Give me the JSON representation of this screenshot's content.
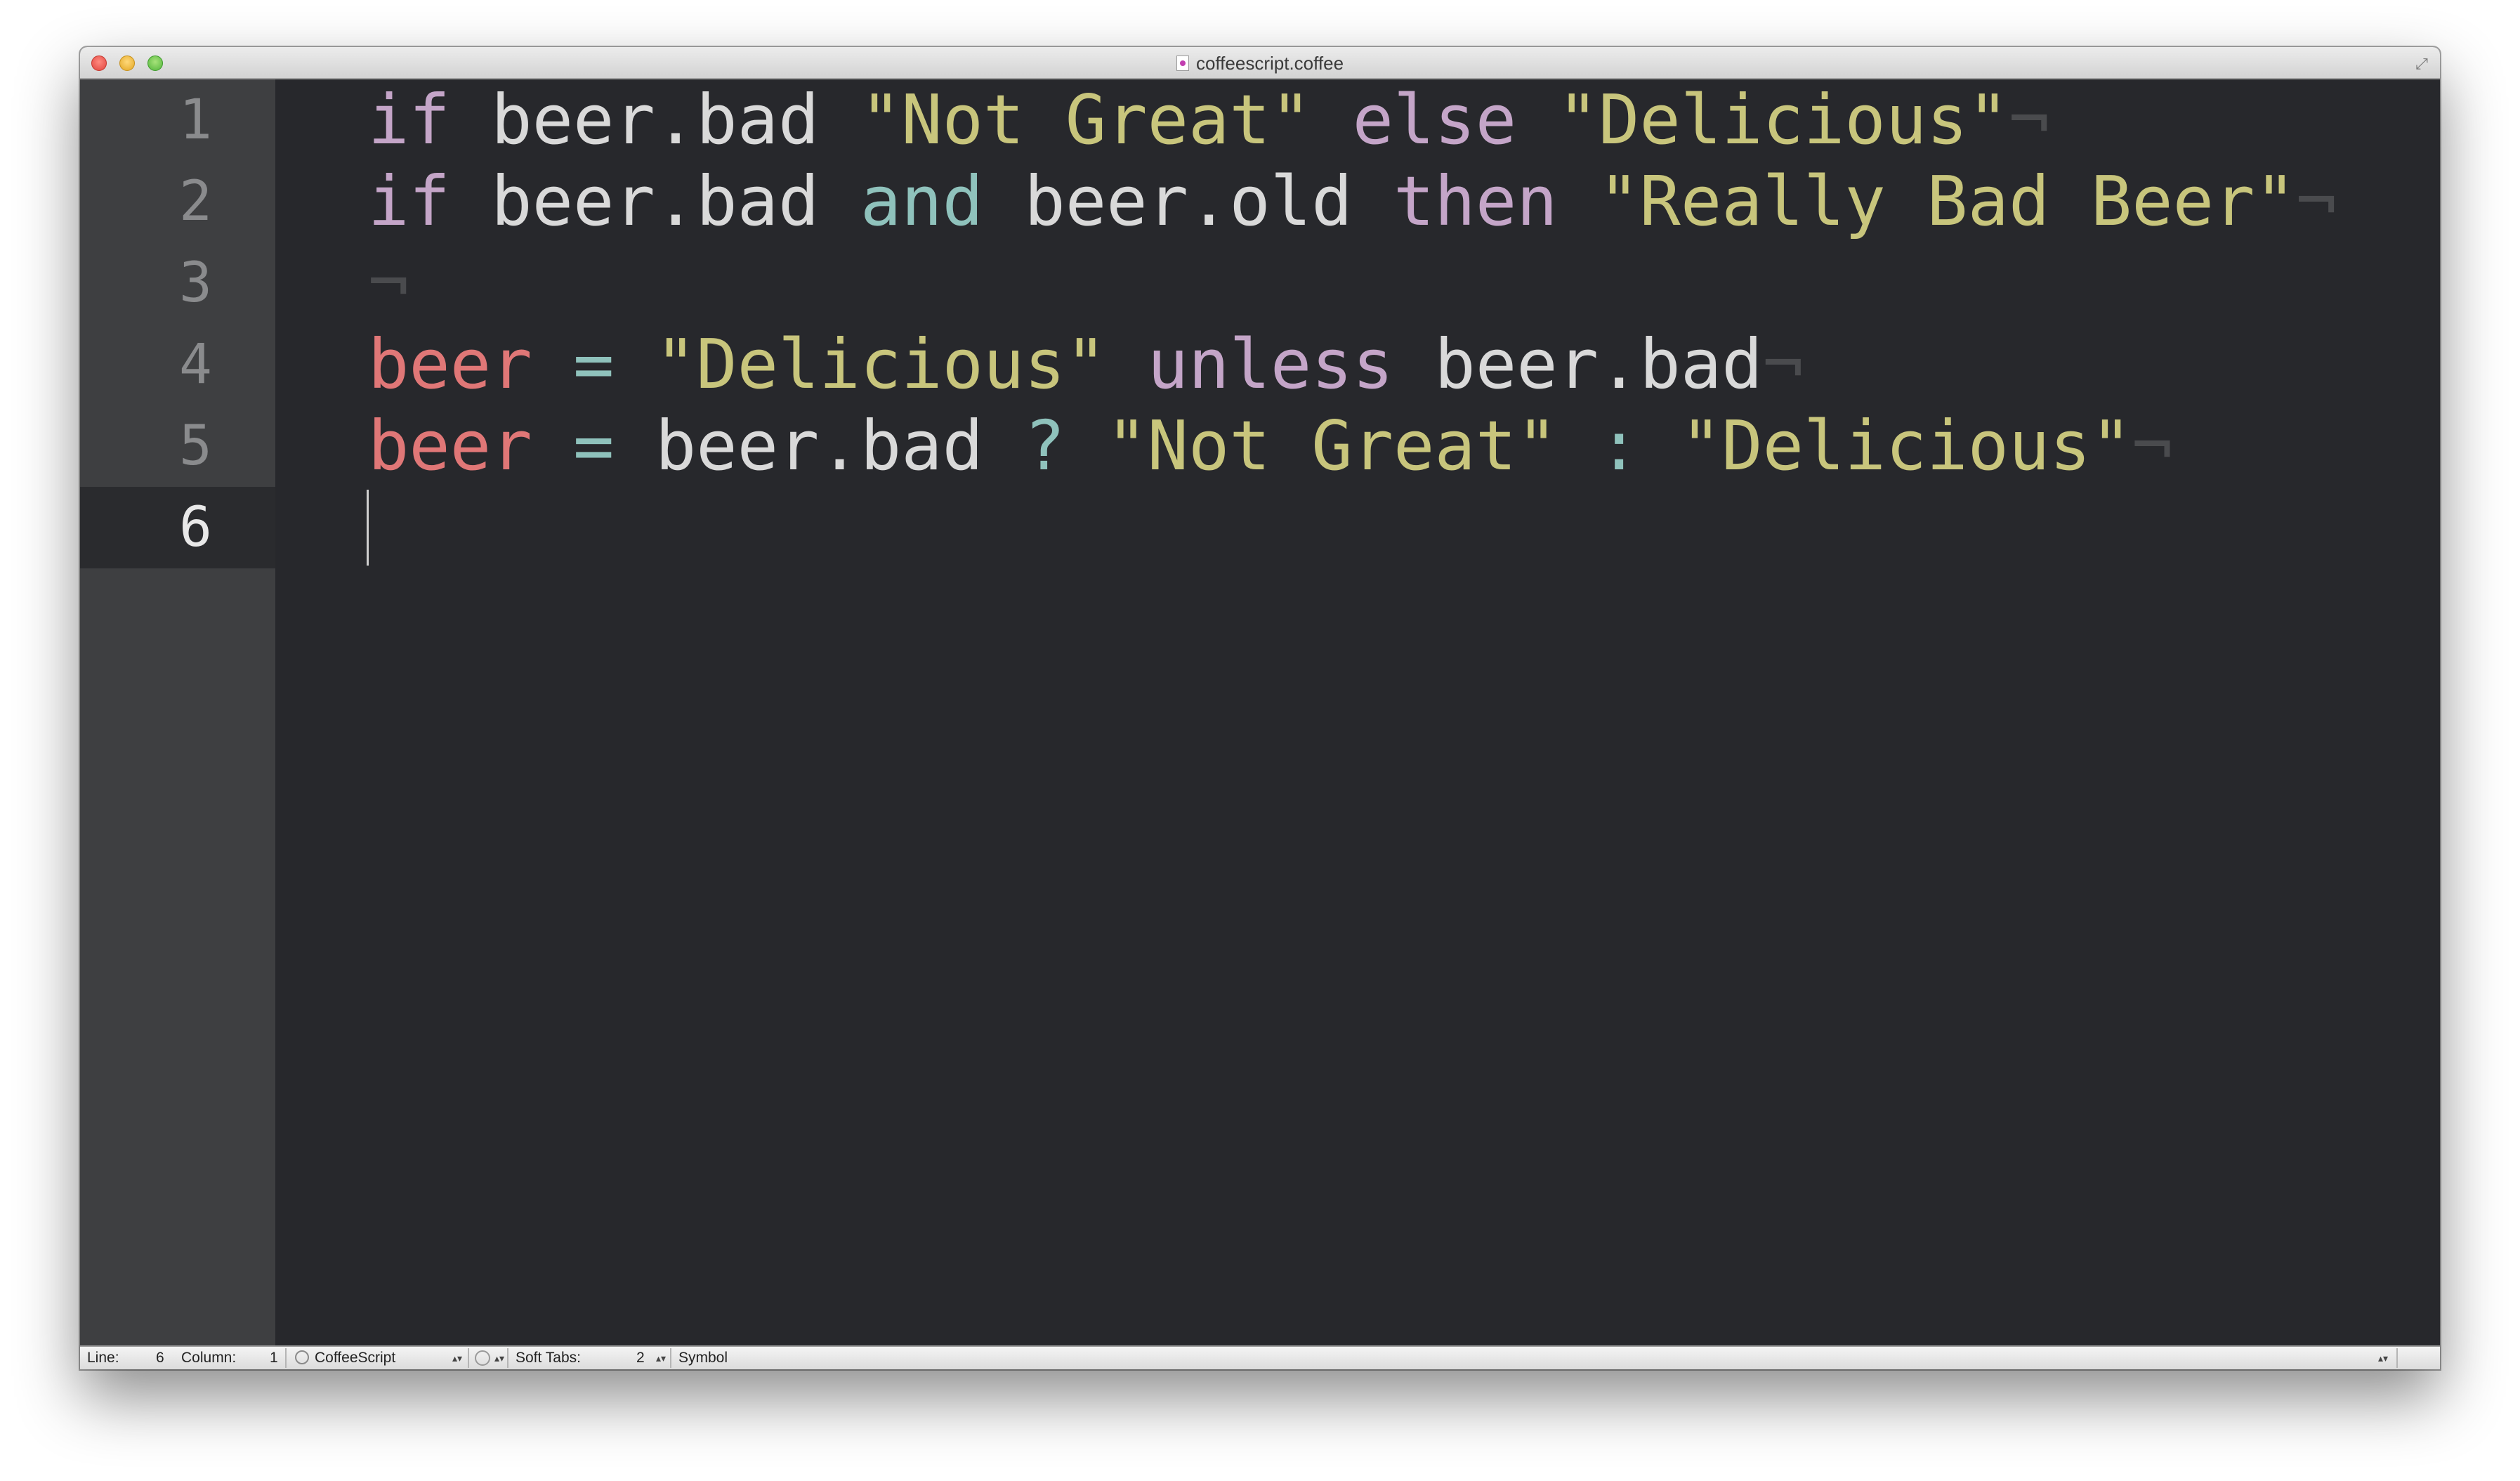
{
  "window": {
    "title": "coffeescript.coffee"
  },
  "gutter": {
    "line_numbers": [
      "1",
      "2",
      "3",
      "4",
      "5",
      "6"
    ],
    "current_line": "6"
  },
  "code": {
    "lines": [
      {
        "tokens": [
          {
            "text": "if",
            "kind": "kw"
          },
          {
            "text": " beer.bad ",
            "kind": "plain"
          },
          {
            "text": "\"Not Great\"",
            "kind": "str"
          },
          {
            "text": " ",
            "kind": "plain"
          },
          {
            "text": "else",
            "kind": "kw"
          },
          {
            "text": " ",
            "kind": "plain"
          },
          {
            "text": "\"Delicious\"",
            "kind": "str"
          },
          {
            "text": "¬",
            "kind": "eol"
          }
        ]
      },
      {
        "tokens": [
          {
            "text": "if",
            "kind": "kw"
          },
          {
            "text": " beer.bad ",
            "kind": "plain"
          },
          {
            "text": "and",
            "kind": "kw2"
          },
          {
            "text": " beer.old ",
            "kind": "plain"
          },
          {
            "text": "then",
            "kind": "kw"
          },
          {
            "text": " ",
            "kind": "plain"
          },
          {
            "text": "\"Really Bad Beer\"",
            "kind": "str"
          },
          {
            "text": "¬",
            "kind": "eol"
          }
        ]
      },
      {
        "tokens": [
          {
            "text": "¬",
            "kind": "eol"
          }
        ]
      },
      {
        "tokens": [
          {
            "text": "beer",
            "kind": "var"
          },
          {
            "text": " ",
            "kind": "plain"
          },
          {
            "text": "=",
            "kind": "op"
          },
          {
            "text": " ",
            "kind": "plain"
          },
          {
            "text": "\"Delicious\"",
            "kind": "str"
          },
          {
            "text": " ",
            "kind": "plain"
          },
          {
            "text": "unless",
            "kind": "kw"
          },
          {
            "text": " beer.bad",
            "kind": "plain"
          },
          {
            "text": "¬",
            "kind": "eol"
          }
        ]
      },
      {
        "tokens": [
          {
            "text": "beer",
            "kind": "var"
          },
          {
            "text": " ",
            "kind": "plain"
          },
          {
            "text": "=",
            "kind": "op"
          },
          {
            "text": " beer.bad ",
            "kind": "plain"
          },
          {
            "text": "?",
            "kind": "op"
          },
          {
            "text": " ",
            "kind": "plain"
          },
          {
            "text": "\"Not Great\"",
            "kind": "str"
          },
          {
            "text": " ",
            "kind": "plain"
          },
          {
            "text": ":",
            "kind": "op"
          },
          {
            "text": " ",
            "kind": "plain"
          },
          {
            "text": "\"Delicious\"",
            "kind": "str"
          },
          {
            "text": "¬",
            "kind": "eol"
          }
        ]
      },
      {
        "tokens": []
      }
    ]
  },
  "statusbar": {
    "line_label": "Line:",
    "line_value": "6",
    "column_label": "Column:",
    "column_value": "1",
    "language": "CoffeeScript",
    "tabs_label": "Soft Tabs:",
    "tabs_value": "2",
    "symbol": "Symbol"
  },
  "colors": {
    "background": "#27282c",
    "gutter": "#3e3f41",
    "keyword": "#c4a5c8",
    "keyword_alt": "#8fc2bc",
    "string": "#c8c57c",
    "variable": "#e07777",
    "plain": "#d9d9d9"
  }
}
